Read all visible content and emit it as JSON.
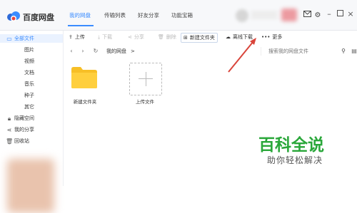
{
  "app": {
    "name": "百度网盘"
  },
  "header": {
    "nav": [
      {
        "label": "我的网盘",
        "active": true
      },
      {
        "label": "传输列表",
        "active": false
      },
      {
        "label": "好友分享",
        "active": false
      },
      {
        "label": "功能宝箱",
        "active": false
      }
    ],
    "icons": [
      "envelope-icon",
      "settings-icon",
      "minimize-icon",
      "maximize-icon",
      "close-icon"
    ]
  },
  "sidebar": {
    "items": [
      {
        "label": "全部文件",
        "icon": "folder-icon",
        "active": true
      },
      {
        "label": "图片",
        "sub": true
      },
      {
        "label": "视频",
        "sub": true
      },
      {
        "label": "文档",
        "sub": true
      },
      {
        "label": "音乐",
        "sub": true
      },
      {
        "label": "种子",
        "sub": true
      },
      {
        "label": "其它",
        "sub": true
      },
      {
        "label": "隐藏空间",
        "icon": "lock-icon"
      },
      {
        "label": "我的分享",
        "icon": "share-icon"
      },
      {
        "label": "回收站",
        "icon": "trash-icon"
      }
    ]
  },
  "toolbar": {
    "upload": "上传",
    "download": "下载",
    "share": "分享",
    "delete": "删除",
    "new_folder": "新建文件夹",
    "offline_download": "离线下载",
    "more": "更多"
  },
  "addressbar": {
    "path": "我的网盘",
    "separator": ">",
    "search_placeholder": "搜索我的网盘文件"
  },
  "files": [
    {
      "name": "新建文件夹",
      "type": "folder"
    },
    {
      "name": "上传文件",
      "type": "upload"
    }
  ],
  "watermark": {
    "title": "百科全说",
    "subtitle": "助你轻松解决"
  },
  "colors": {
    "accent": "#3b8cff",
    "folder": "#ffcf3d",
    "arrow": "#d9453b",
    "watermark_green": "#2aa73a"
  }
}
